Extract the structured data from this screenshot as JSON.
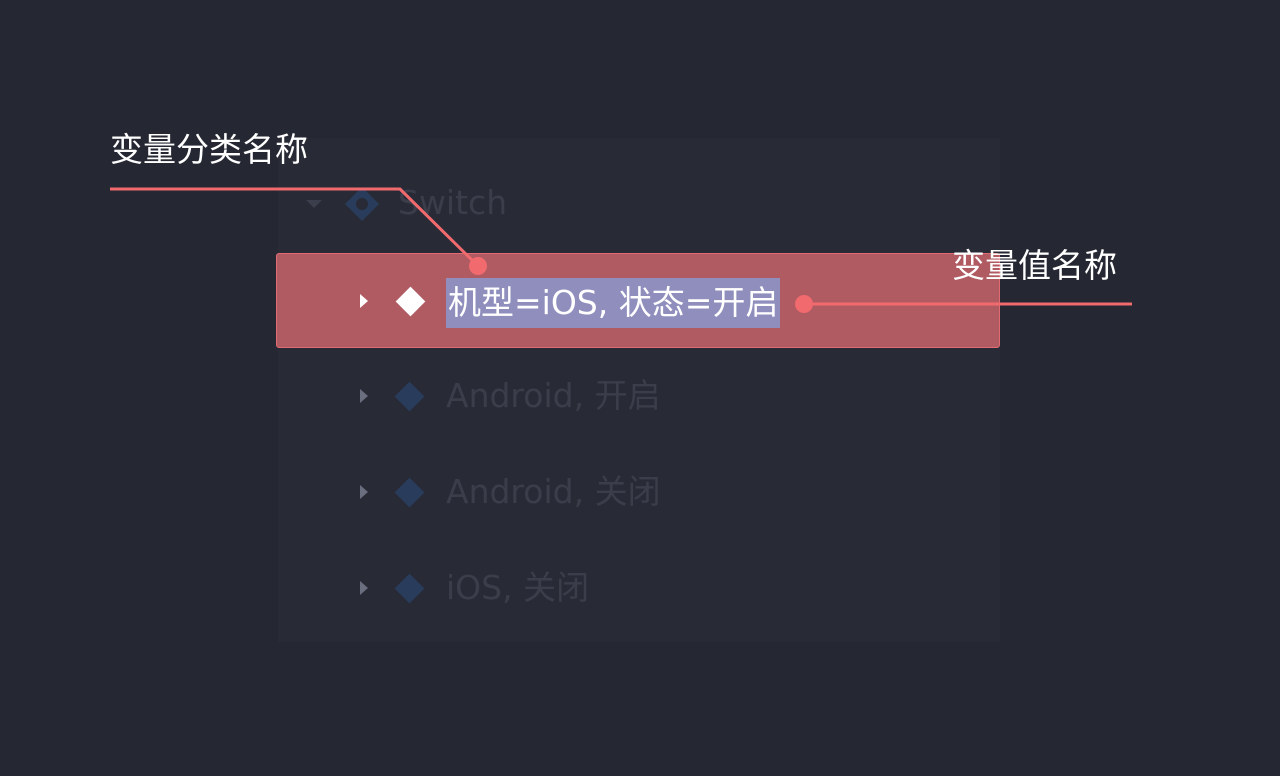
{
  "tree": {
    "parent": {
      "label": "Switch",
      "icon": "component-set-icon"
    },
    "selected": {
      "label": "机型=iOS, 状态=开启",
      "icon": "diamond-icon"
    },
    "items": [
      {
        "label": "Android, 开启",
        "icon": "diamond-icon"
      },
      {
        "label": "Android, 关闭",
        "icon": "diamond-icon"
      },
      {
        "label": "iOS, 关闭",
        "icon": "diamond-icon"
      }
    ]
  },
  "annotations": {
    "category_name": "变量分类名称",
    "value_name": "变量值名称"
  },
  "colors": {
    "background": "#252733",
    "panel": "#282a35",
    "selection": "#b05a62",
    "text_highlight": "#8f8ebd",
    "annotation_line": "#f06a6e",
    "dim_diamond": "#2a3c5c"
  }
}
